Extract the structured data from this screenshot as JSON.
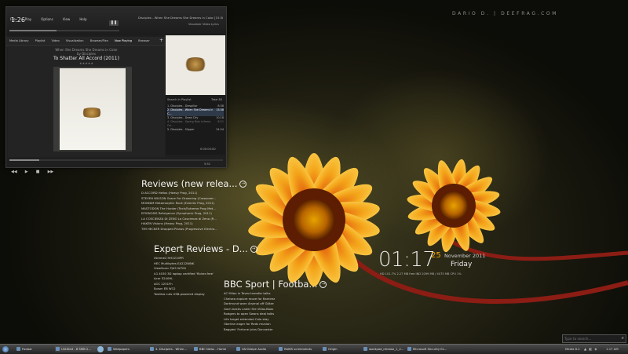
{
  "player": {
    "time": "1:26",
    "menu": [
      "File",
      "Play",
      "Options",
      "View",
      "Help"
    ],
    "title_bar": "Disciples - When She Dreams She Dreams in Color [15:38]",
    "controls_top": [
      "Visualizer",
      "Video",
      "Lyrics"
    ],
    "nav_tabs": [
      "Media Library",
      "Playlist",
      "Video",
      "Visualization",
      "Browser/Flex",
      "Now Playing",
      "Browser"
    ],
    "track_title": "When She Dreams She Dreams in Color",
    "track_by": "by Disciples",
    "album": "To Shatter All Accord (2011)",
    "rating": "★★★★★",
    "playlist_header": "Search in Playlist",
    "playlist_total": "Total 80",
    "playlist": [
      {
        "title": "1. Disciples - Diespillar",
        "time": "8:38"
      },
      {
        "title": "2. Disciples - When She Dreams in C...",
        "time": "13:38"
      },
      {
        "title": "3. Disciples - Dead City",
        "time": "10:18"
      },
      {
        "title": "4. Disciples - Spring Ruin Inferno Ori...",
        "time": "8:21"
      },
      {
        "title": "5. Disciples - Slipper",
        "time": "24:54"
      }
    ],
    "playlist_time": "0:00:00:00",
    "volume": "5:51"
  },
  "watermark": "DARIO D.  |  DEEFRAG.COM",
  "reviews": {
    "title": "Reviews (new relea...",
    "items": [
      "D ACCORD Helios (Heavy Prog, 2011)",
      "STEVEN WILSON Grace For Drowning (Crossover...",
      "MONNIM Metamorphic Rock (Eclectic Prog, 2011)",
      "MASTODON The Hunter (Tech/Extreme Prog Met...",
      "EPIGNOSIS Refulgence (Symphonic Prog, 2011)",
      "LA COSCIENZA DI ZENO La Coscienza di Zeno (R...",
      "HAKEN Visions (Heavy Prog, 2011)",
      "TIM HECKER Dropped Pianos (Progressive Electro..."
    ]
  },
  "expert": {
    "title": "Expert Reviews - D...",
    "items": [
      "Xtreme2 HH2210PR",
      "HEC Multibytes EA222WNK",
      "ViewSonic PJ45 W700",
      "LG 4030 3D laptop certified 'flicker-free'",
      "Acer S240HL",
      "AOC 2251Fh",
      "Epson EB W12",
      "Toshiba cuts USB-powered display"
    ]
  },
  "bbc": {
    "title": "BBC Sport | Footba...",
    "items": [
      "AC Milan in Tevez transfer talks",
      "Chelsea explore move for Ramirez",
      "Dortmund warn Arsenal off Götze",
      "Goch backs under fire Villas-Boas",
      "Rodgers to open Swans deal talks",
      "Life target extended Cole stay",
      "Oberlan eager for Reds reunion",
      "Baggies' Fortune joins Doncaster"
    ]
  },
  "clock": {
    "time": "01:17",
    "day": "25",
    "month_year": "November 2011",
    "weekday": "Friday",
    "stats": "HD 101.7% 2.27 MB  free  IND 2099 MB / 4075 MB  CPU 1%"
  },
  "search": {
    "placeholder": "Type to search..."
  },
  "taskbar": {
    "tasks": [
      "Foobar",
      "Untitled - 8 SMB 2...",
      "Wallpapers",
      "4. Disciples - When...",
      "BBC News - Home",
      "VAI Keepe Audio",
      "RAWS screenshots",
      "Origin",
      "wordpad_release_1_2...",
      "Microsoft Security Es..."
    ],
    "tray": "Media 8.2",
    "clock": "1:17 AM"
  },
  "colors": {
    "accent": "#f0a800",
    "petal": "#f3a21a",
    "stem": "#8b1d14"
  }
}
